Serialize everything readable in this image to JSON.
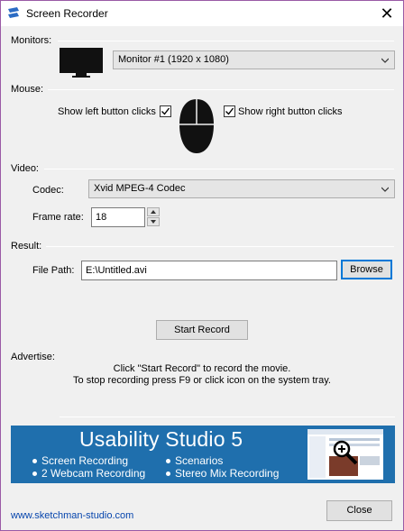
{
  "window": {
    "title": "Screen Recorder"
  },
  "monitors": {
    "section_label": "Monitors:",
    "selected": "Monitor #1 (1920 x 1080)"
  },
  "mouse": {
    "section_label": "Mouse:",
    "left_label": "Show left button clicks",
    "left_checked": true,
    "right_label": "Show right button clicks",
    "right_checked": true
  },
  "video": {
    "section_label": "Video:",
    "codec_label": "Codec:",
    "codec_value": "Xvid MPEG-4 Codec",
    "framerate_label": "Frame rate:",
    "framerate_value": "18"
  },
  "result": {
    "section_label": "Result:",
    "filepath_label": "File Path:",
    "filepath_value": "E:\\Untitled.avi",
    "browse_label": "Browse"
  },
  "actions": {
    "start_label": "Start Record",
    "close_label": "Close"
  },
  "advertise": {
    "section_label": "Advertise:",
    "line1": "Click \"Start Record\" to record the movie.",
    "line2": "To stop recording press F9 or click icon on the system tray."
  },
  "banner": {
    "title": "Usability Studio 5",
    "items": [
      "Screen Recording",
      "Scenarios",
      "2 Webcam Recording",
      "Stereo Mix Recording"
    ]
  },
  "footer": {
    "website": "www.sketchman-studio.com"
  },
  "colors": {
    "banner_bg": "#1f6fad",
    "accent_border": "#0078d7",
    "link": "#0645ad"
  }
}
